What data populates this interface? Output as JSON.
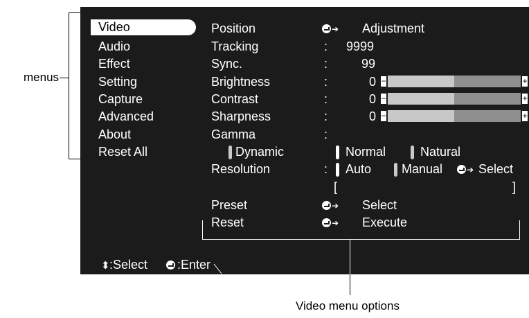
{
  "menu": {
    "items": [
      "Video",
      "Audio",
      "Effect",
      "Setting",
      "Capture",
      "Advanced",
      "About",
      "Reset All"
    ],
    "selected": "Video"
  },
  "options": {
    "position": {
      "label": "Position",
      "action": "Adjustment"
    },
    "tracking": {
      "label": "Tracking",
      "value": "9999"
    },
    "sync": {
      "label": "Sync.",
      "value": "99"
    },
    "brightness": {
      "label": "Brightness",
      "value": "0",
      "level": 0.5
    },
    "contrast": {
      "label": "Contrast",
      "value": "0",
      "level": 0.5
    },
    "sharpness": {
      "label": "Sharpness",
      "value": "0",
      "level": 0.5
    },
    "gamma": {
      "label": "Gamma",
      "choices": [
        "Dynamic",
        "Normal",
        "Natural"
      ],
      "selected": "Normal"
    },
    "resolution": {
      "label": "Resolution",
      "choices": [
        "Auto",
        "Manual"
      ],
      "selected": "Auto",
      "action": "Select",
      "bracket_open": "[",
      "bracket_close": "]"
    },
    "preset": {
      "label": "Preset",
      "action": "Select"
    },
    "reset": {
      "label": "Reset",
      "action": "Execute"
    }
  },
  "footer": {
    "select_hint": ":Select",
    "enter_hint": ":Enter"
  },
  "annotations": {
    "menus": "menus",
    "options": "Video menu options"
  },
  "colors": {
    "screen_bg": "#1b1b1b",
    "text": "#ffffff",
    "slider_light": "#c8c8c8",
    "slider_dark": "#8f8f8f"
  },
  "icons": {
    "enter": "enter-icon",
    "arrow": "right-arrow-icon",
    "updown": "up-down-arrow-icon"
  }
}
